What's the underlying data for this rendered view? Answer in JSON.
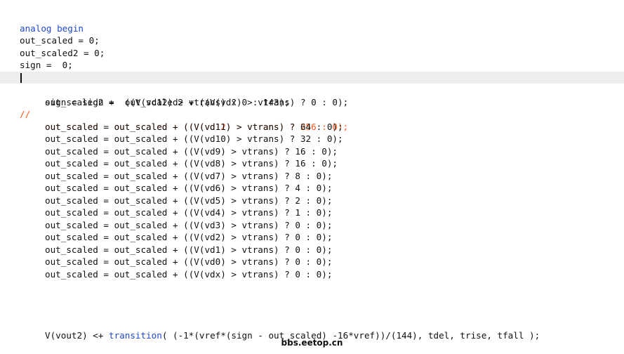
{
  "colors": {
    "keyword": "#1f48d8",
    "comment": "#ff5a1a",
    "text": "#111111",
    "current_line": "#eeeeee"
  },
  "header": [
    {
      "keyword": "analog begin",
      "text": ""
    },
    {
      "text": "out_scaled = 0;"
    },
    {
      "text": "out_scaled2 = 0;"
    },
    {
      "text": "sign =  0;"
    }
  ],
  "body": [
    {
      "text": "sign = sign +  ((V(vd12) > vtrans) ? 0 : 143);",
      "current": true
    },
    {
      "text": "out_scaled2 =  out_scaled2 + ((V(vdx) > vtrans) ? 0 : 0);"
    },
    {
      "marker": "//",
      "text": "out_scaled = out_scaled + ((V(vd12) > vtrans) ? 256 : 0);",
      "commented": true
    },
    {
      "text": "out_scaled = out_scaled + ((V(vd11) > vtrans) ? 64 : 0);"
    },
    {
      "text": "out_scaled = out_scaled + ((V(vd10) > vtrans) ? 32 : 0);"
    },
    {
      "text": "out_scaled = out_scaled + ((V(vd9) > vtrans) ? 16 : 0);"
    },
    {
      "text": "out_scaled = out_scaled + ((V(vd8) > vtrans) ? 16 : 0);"
    },
    {
      "text": "out_scaled = out_scaled + ((V(vd7) > vtrans) ? 8 : 0);"
    },
    {
      "text": "out_scaled = out_scaled + ((V(vd6) > vtrans) ? 4 : 0);"
    },
    {
      "text": "out_scaled = out_scaled + ((V(vd5) > vtrans) ? 2 : 0);"
    },
    {
      "text": "out_scaled = out_scaled + ((V(vd4) > vtrans) ? 1 : 0);"
    },
    {
      "text": "out_scaled = out_scaled + ((V(vd3) > vtrans) ? 0 : 0);"
    },
    {
      "text": "out_scaled = out_scaled + ((V(vd2) > vtrans) ? 0 : 0);"
    },
    {
      "text": "out_scaled = out_scaled + ((V(vd1) > vtrans) ? 0 : 0);"
    },
    {
      "text": "out_scaled = out_scaled + ((V(vd0) > vtrans) ? 0 : 0);"
    },
    {
      "text": "out_scaled = out_scaled + ((V(vdx) > vtrans) ? 0 : 0);"
    }
  ],
  "footer": {
    "prefix": "V(vout2) <+ ",
    "function": "transition",
    "suffix": "( (-1*(vref*(sign - out_scaled) -16*vref))/(144), tdel, trise, tfall );"
  },
  "watermark": "bbs.eetop.cn"
}
